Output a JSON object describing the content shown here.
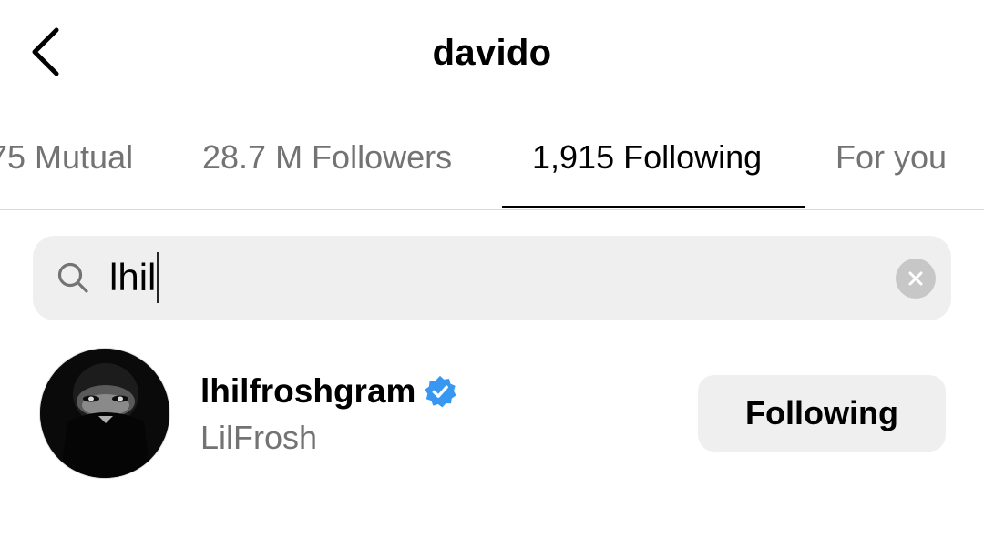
{
  "header": {
    "title": "davido",
    "back_icon": "chevron-left-icon"
  },
  "tabs": [
    {
      "label": "75 Mutual",
      "active": false
    },
    {
      "label": "28.7 M Followers",
      "active": false
    },
    {
      "label": "1,915 Following",
      "active": true
    },
    {
      "label": "For you",
      "active": false
    }
  ],
  "search": {
    "icon": "search-icon",
    "value": "lhil",
    "clear_icon": "clear-icon"
  },
  "results": [
    {
      "username": "lhilfroshgram",
      "verified": true,
      "display_name": "LilFrosh",
      "button_label": "Following"
    }
  ],
  "colors": {
    "text_primary": "#000000",
    "text_secondary": "#737373",
    "search_bg": "#efefef",
    "button_bg": "#efefef",
    "verified_blue": "#3897f0",
    "divider": "#dbdbdb"
  }
}
